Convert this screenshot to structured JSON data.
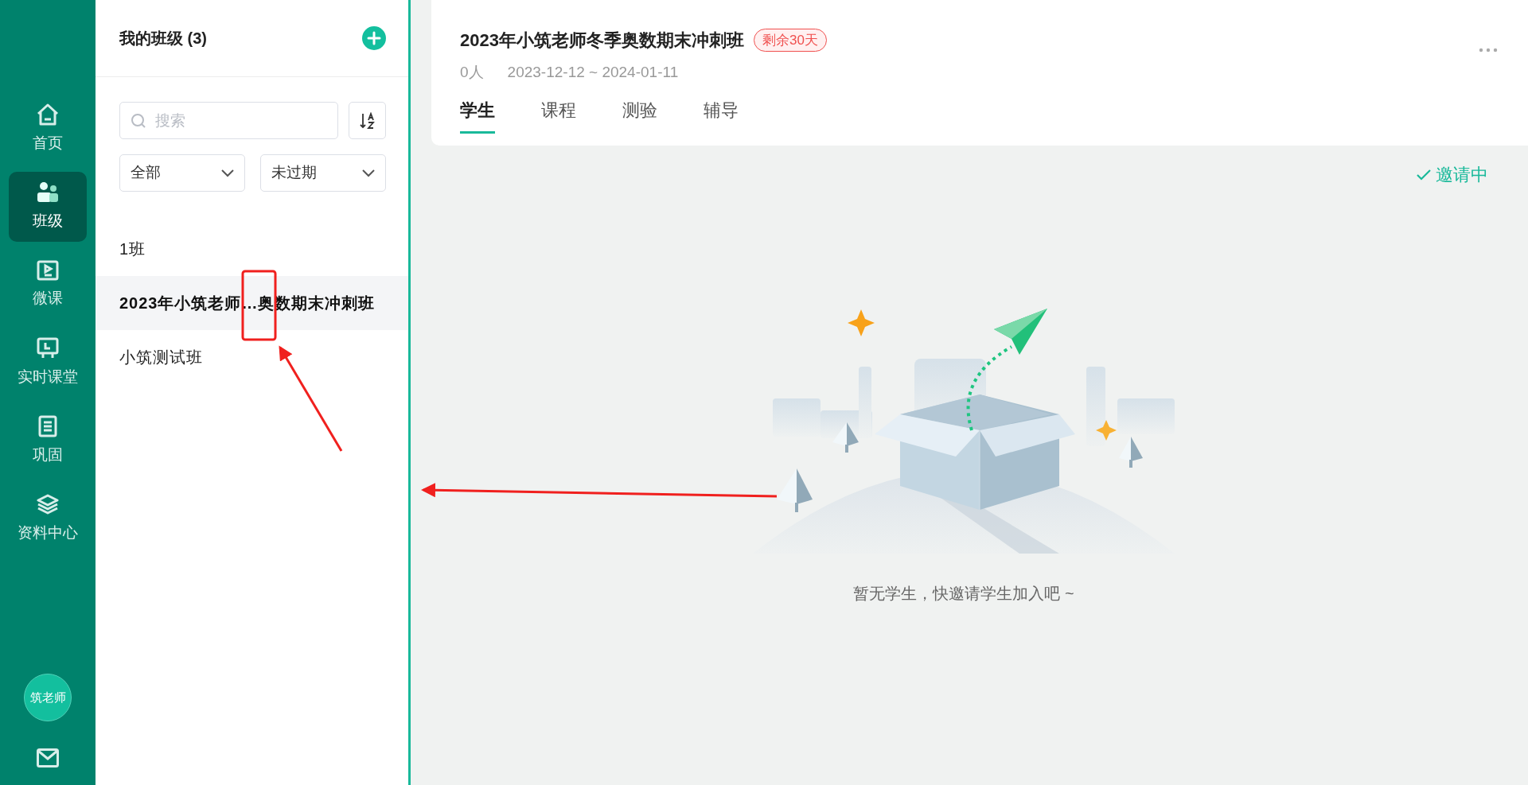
{
  "nav": {
    "items": [
      {
        "label": "首页",
        "selected": false
      },
      {
        "label": "班级",
        "selected": true
      },
      {
        "label": "微课",
        "selected": false
      },
      {
        "label": "实时课堂",
        "selected": false
      },
      {
        "label": "巩固",
        "selected": false
      },
      {
        "label": "资料中心",
        "selected": false
      }
    ],
    "avatar_text": "筑老师"
  },
  "class_list": {
    "title": "我的班级 (3)",
    "search": {
      "placeholder": "搜索"
    },
    "filters": [
      {
        "value": "全部"
      },
      {
        "value": "未过期"
      }
    ],
    "items": [
      {
        "label": "1班",
        "selected": false
      },
      {
        "label": "2023年小筑老师…奥数期末冲刺班",
        "selected": true
      },
      {
        "label": "小筑测试班",
        "selected": false
      }
    ]
  },
  "detail": {
    "title": "2023年小筑老师冬季奥数期末冲刺班",
    "badge": "剩余30天",
    "count": "0人",
    "date_range": "2023-12-12 ~ 2024-01-11",
    "tabs": [
      {
        "label": "学生",
        "selected": true
      },
      {
        "label": "课程",
        "selected": false
      },
      {
        "label": "测验",
        "selected": false
      },
      {
        "label": "辅导",
        "selected": false
      }
    ],
    "invite_status": "邀请中",
    "empty_message": "暂无学生，快邀请学生加入吧 ~"
  }
}
